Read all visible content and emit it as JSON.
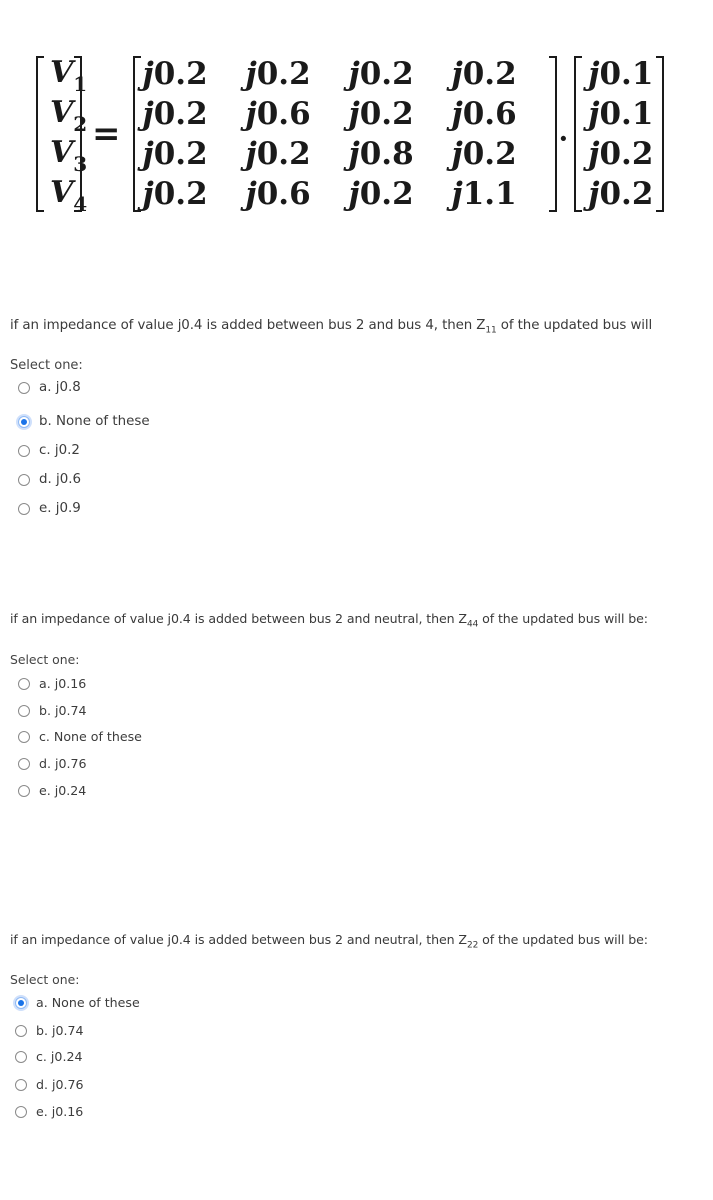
{
  "equation": {
    "voltage_vector": [
      {
        "symbol": "V",
        "sub": "1"
      },
      {
        "symbol": "V",
        "sub": "2"
      },
      {
        "symbol": "V",
        "sub": "3"
      },
      {
        "symbol": "V",
        "sub": "4"
      }
    ],
    "equals": "=",
    "z_matrix": [
      [
        {
          "j": "j",
          "n": "0.2"
        },
        {
          "j": "j",
          "n": "0.2"
        },
        {
          "j": "j",
          "n": "0.2"
        },
        {
          "j": "j",
          "n": "0.2"
        }
      ],
      [
        {
          "j": "j",
          "n": "0.2"
        },
        {
          "j": "j",
          "n": "0.6"
        },
        {
          "j": "j",
          "n": "0.2"
        },
        {
          "j": "j",
          "n": "0.6"
        }
      ],
      [
        {
          "j": "j",
          "n": "0.2"
        },
        {
          "j": "j",
          "n": "0.2"
        },
        {
          "j": "j",
          "n": "0.8"
        },
        {
          "j": "j",
          "n": "0.2"
        }
      ],
      [
        {
          "j": "j",
          "n": "0.2"
        },
        {
          "j": "j",
          "n": "0.6"
        },
        {
          "j": "j",
          "n": "0.2"
        },
        {
          "j": "j",
          "n": "1.1"
        }
      ]
    ],
    "dot": "·",
    "current_vector": [
      {
        "j": "j",
        "n": "0.1"
      },
      {
        "j": "j",
        "n": "0.1"
      },
      {
        "j": "j",
        "n": "0.2"
      },
      {
        "j": "j",
        "n": "0.2"
      }
    ]
  },
  "questions": [
    {
      "text_before": "if an impedance of value j0.4 is added between bus 2 and bus 4, then Z",
      "subscript": "11",
      "text_after": " of the updated bus will",
      "select_label": "Select one:",
      "options": [
        {
          "label": "a. j0.8",
          "checked": false
        },
        {
          "label": "b. None of these",
          "checked": true
        },
        {
          "label": "c. j0.2",
          "checked": false
        },
        {
          "label": "d. j0.6",
          "checked": false
        },
        {
          "label": "e. j0.9",
          "checked": false
        }
      ]
    },
    {
      "text_before": "if an impedance of value j0.4 is added between bus 2 and neutral, then Z",
      "subscript": "44",
      "text_after": " of the updated bus will be:",
      "select_label": "Select one:",
      "options": [
        {
          "label": "a. j0.16",
          "checked": false
        },
        {
          "label": "b. j0.74",
          "checked": false
        },
        {
          "label": "c. None of these",
          "checked": false
        },
        {
          "label": "d. j0.76",
          "checked": false
        },
        {
          "label": "e. j0.24",
          "checked": false
        }
      ]
    },
    {
      "text_before": "if an impedance of value j0.4 is added between bus 2 and neutral, then Z",
      "subscript": "22",
      "text_after": " of the updated bus will be:",
      "select_label": "Select one:",
      "options": [
        {
          "label": "a. None of these",
          "checked": true
        },
        {
          "label": "b. j0.74",
          "checked": false
        },
        {
          "label": "c. j0.24",
          "checked": false
        },
        {
          "label": "d. j0.76",
          "checked": false
        },
        {
          "label": "e. j0.16",
          "checked": false
        }
      ]
    }
  ],
  "colors": {
    "radio_checked": "#1a73e8",
    "radio_border": "#8a8a8a",
    "text": "#3a3a3a"
  }
}
